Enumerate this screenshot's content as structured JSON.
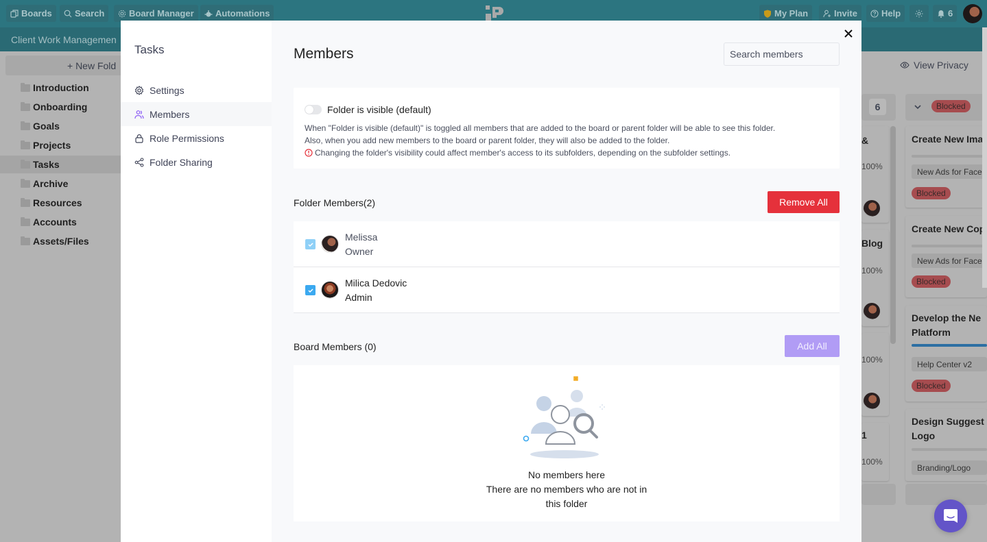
{
  "topbar": {
    "left_buttons": [
      {
        "label": "Boards",
        "icon": "boards-icon"
      },
      {
        "label": "Search",
        "icon": "search-icon"
      },
      {
        "label": "Board Manager",
        "icon": "gear-icon"
      },
      {
        "label": "Automations",
        "icon": "robot-icon"
      }
    ],
    "right_buttons": [
      {
        "label": "My Plan",
        "icon": "shield-icon"
      },
      {
        "label": "Invite",
        "icon": "add-user-icon"
      },
      {
        "label": "Help",
        "icon": "help-icon"
      },
      {
        "label": "",
        "icon": "sun-icon"
      },
      {
        "label": "6",
        "icon": "bell-icon"
      }
    ],
    "colors": {
      "bar": "#2c7580",
      "shield": "#c89a1a"
    }
  },
  "board": {
    "title": "Client Work Managemen",
    "new_folder_label": "+ New Fold",
    "folders": [
      "Introduction",
      "Onboarding",
      "Goals",
      "Projects",
      "Tasks",
      "Archive",
      "Resources",
      "Accounts",
      "Assets/Files"
    ],
    "active_folder": "Tasks",
    "view_privacy_label": "View Privacy",
    "column_count": "6",
    "column_status": "Blocked",
    "left_column_cards": [
      {
        "title_fragment": "&",
        "percent": "100%"
      },
      {
        "title_fragment": "Blog",
        "percent": "100%"
      },
      {
        "title_fragment": "",
        "percent": "100%"
      },
      {
        "title_fragment": "1",
        "percent": "100%"
      }
    ],
    "right_column_cards": [
      {
        "title": "Create New Ima",
        "tag": "New Ads for Face",
        "status": "Blocked"
      },
      {
        "title": "Create New Cop",
        "tag": "New Ads for Face",
        "status": "Blocked"
      },
      {
        "title": "Develop the New Platform",
        "tag": "Help Center v2",
        "status": "Blocked",
        "progress": 1.0
      },
      {
        "title": "Design Suggest Logo",
        "tag": "Branding/Logo"
      }
    ]
  },
  "modal": {
    "nav_title": "Tasks",
    "nav_items": [
      {
        "label": "Settings",
        "icon": "gear-icon"
      },
      {
        "label": "Members",
        "icon": "users-icon",
        "active": true
      },
      {
        "label": "Role Permissions",
        "icon": "lock-icon"
      },
      {
        "label": "Folder Sharing",
        "icon": "share-icon"
      }
    ],
    "title": "Members",
    "search_placeholder": "Search members",
    "visibility": {
      "label": "Folder is visible (default)",
      "enabled": false,
      "desc_line1": "When \"Folder is visible (default)\" is toggled all members that are added to the board or parent folder will be able to see this folder.",
      "desc_line2": "Also, when you add new members to the board or parent folder, they will also be added to the folder.",
      "warning": "Changing the folder's visibility could affect member's access to its subfolders, depending on the subfolder settings."
    },
    "folder_members": {
      "title": "Folder Members(2)",
      "remove_all_label": "Remove All",
      "members": [
        {
          "name": "Melissa",
          "role": "Owner",
          "checked": true,
          "disabled": true
        },
        {
          "name": "Milica Dedovic",
          "role": "Admin",
          "checked": true,
          "disabled": false
        }
      ]
    },
    "board_members": {
      "title": "Board Members (0)",
      "add_all_label": "Add All",
      "empty_title": "No members here",
      "empty_line1": "There are no members who are not in",
      "empty_line2": "this folder"
    },
    "colors": {
      "danger": "#e5313b",
      "primary_disabled": "#b19cf5",
      "accent": "#8b5cf6",
      "check": "#3ba9f0",
      "check_disabled": "#8fd0f7",
      "warn": "#e5313b"
    }
  }
}
